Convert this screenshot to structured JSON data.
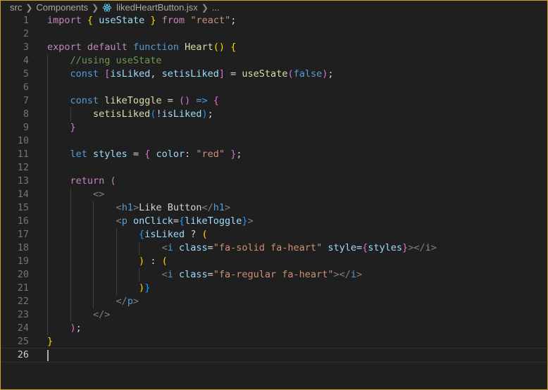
{
  "breadcrumb": {
    "items": [
      "src",
      "Components",
      "likedHeartButton.jsx",
      "..."
    ]
  },
  "editor": {
    "language": "jsx",
    "current_line": 26,
    "lines": [
      {
        "n": "1"
      },
      {
        "n": "2"
      },
      {
        "n": "3"
      },
      {
        "n": "4"
      },
      {
        "n": "5"
      },
      {
        "n": "6"
      },
      {
        "n": "7"
      },
      {
        "n": "8"
      },
      {
        "n": "9"
      },
      {
        "n": "10"
      },
      {
        "n": "11"
      },
      {
        "n": "12"
      },
      {
        "n": "13"
      },
      {
        "n": "14"
      },
      {
        "n": "15"
      },
      {
        "n": "16"
      },
      {
        "n": "17"
      },
      {
        "n": "18"
      },
      {
        "n": "19"
      },
      {
        "n": "20"
      },
      {
        "n": "21"
      },
      {
        "n": "22"
      },
      {
        "n": "23"
      },
      {
        "n": "24"
      },
      {
        "n": "25"
      },
      {
        "n": "26"
      }
    ],
    "tokens": [
      [
        [
          "kw",
          "import"
        ],
        [
          "op",
          " "
        ],
        [
          "b1",
          "{"
        ],
        [
          "op",
          " "
        ],
        [
          "var",
          "useState"
        ],
        [
          "op",
          " "
        ],
        [
          "b1",
          "}"
        ],
        [
          "op",
          " "
        ],
        [
          "kw",
          "from"
        ],
        [
          "op",
          " "
        ],
        [
          "str",
          "\"react\""
        ],
        [
          "op",
          ";"
        ]
      ],
      [],
      [
        [
          "kw",
          "export"
        ],
        [
          "op",
          " "
        ],
        [
          "kw",
          "default"
        ],
        [
          "op",
          " "
        ],
        [
          "kb",
          "function"
        ],
        [
          "op",
          " "
        ],
        [
          "fn",
          "Heart"
        ],
        [
          "b1",
          "()"
        ],
        [
          "op",
          " "
        ],
        [
          "b1",
          "{"
        ]
      ],
      [
        [
          "op",
          "    "
        ],
        [
          "cmt",
          "//using useState"
        ]
      ],
      [
        [
          "op",
          "    "
        ],
        [
          "kb",
          "const"
        ],
        [
          "op",
          " "
        ],
        [
          "b2",
          "["
        ],
        [
          "var",
          "isLiked"
        ],
        [
          "op",
          ", "
        ],
        [
          "var",
          "setisLiked"
        ],
        [
          "b2",
          "]"
        ],
        [
          "op",
          " = "
        ],
        [
          "fn",
          "useState"
        ],
        [
          "b2",
          "("
        ],
        [
          "kb",
          "false"
        ],
        [
          "b2",
          ")"
        ],
        [
          "op",
          ";"
        ]
      ],
      [],
      [
        [
          "op",
          "    "
        ],
        [
          "kb",
          "const"
        ],
        [
          "op",
          " "
        ],
        [
          "fn",
          "likeToggle"
        ],
        [
          "op",
          " = "
        ],
        [
          "b2",
          "()"
        ],
        [
          "op",
          " "
        ],
        [
          "kb",
          "=>"
        ],
        [
          "op",
          " "
        ],
        [
          "b2",
          "{"
        ]
      ],
      [
        [
          "op",
          "        "
        ],
        [
          "fn",
          "setisLiked"
        ],
        [
          "b3",
          "("
        ],
        [
          "op",
          "!"
        ],
        [
          "var",
          "isLiked"
        ],
        [
          "b3",
          ")"
        ],
        [
          "op",
          ";"
        ]
      ],
      [
        [
          "op",
          "    "
        ],
        [
          "b2",
          "}"
        ]
      ],
      [],
      [
        [
          "op",
          "    "
        ],
        [
          "kb",
          "let"
        ],
        [
          "op",
          " "
        ],
        [
          "var",
          "styles"
        ],
        [
          "op",
          " = "
        ],
        [
          "b2",
          "{"
        ],
        [
          "op",
          " "
        ],
        [
          "var",
          "color"
        ],
        [
          "op",
          ": "
        ],
        [
          "str",
          "\"red\""
        ],
        [
          "op",
          " "
        ],
        [
          "b2",
          "}"
        ],
        [
          "op",
          ";"
        ]
      ],
      [],
      [
        [
          "op",
          "    "
        ],
        [
          "kw",
          "return"
        ],
        [
          "op",
          " "
        ],
        [
          "b2",
          "("
        ]
      ],
      [
        [
          "op",
          "        "
        ],
        [
          "tag",
          "<>"
        ]
      ],
      [
        [
          "op",
          "            "
        ],
        [
          "tag",
          "<"
        ],
        [
          "tagn",
          "h1"
        ],
        [
          "tag",
          ">"
        ],
        [
          "op",
          "Like Button"
        ],
        [
          "tag",
          "</"
        ],
        [
          "tagn",
          "h1"
        ],
        [
          "tag",
          ">"
        ]
      ],
      [
        [
          "op",
          "            "
        ],
        [
          "tag",
          "<"
        ],
        [
          "tagn",
          "p"
        ],
        [
          "op",
          " "
        ],
        [
          "attr",
          "onClick"
        ],
        [
          "op",
          "="
        ],
        [
          "b3",
          "{"
        ],
        [
          "var",
          "likeToggle"
        ],
        [
          "b3",
          "}"
        ],
        [
          "tag",
          ">"
        ]
      ],
      [
        [
          "op",
          "                "
        ],
        [
          "b3",
          "{"
        ],
        [
          "var",
          "isLiked"
        ],
        [
          "op",
          " ? "
        ],
        [
          "b1",
          "("
        ]
      ],
      [
        [
          "op",
          "                    "
        ],
        [
          "tag",
          "<"
        ],
        [
          "tagn",
          "i"
        ],
        [
          "op",
          " "
        ],
        [
          "attr",
          "class"
        ],
        [
          "op",
          "="
        ],
        [
          "str",
          "\"fa-solid fa-heart\""
        ],
        [
          "op",
          " "
        ],
        [
          "attr",
          "style"
        ],
        [
          "op",
          "="
        ],
        [
          "b2",
          "{"
        ],
        [
          "var",
          "styles"
        ],
        [
          "b2",
          "}"
        ],
        [
          "tag",
          "></"
        ],
        [
          "tagn",
          "i"
        ],
        [
          "tag",
          ">"
        ]
      ],
      [
        [
          "op",
          "                "
        ],
        [
          "b1",
          ")"
        ],
        [
          "op",
          " : "
        ],
        [
          "b1",
          "("
        ]
      ],
      [
        [
          "op",
          "                    "
        ],
        [
          "tag",
          "<"
        ],
        [
          "tagn",
          "i"
        ],
        [
          "op",
          " "
        ],
        [
          "attr",
          "class"
        ],
        [
          "op",
          "="
        ],
        [
          "str",
          "\"fa-regular fa-heart\""
        ],
        [
          "tag",
          "></"
        ],
        [
          "tagn",
          "i"
        ],
        [
          "tag",
          ">"
        ]
      ],
      [
        [
          "op",
          "                "
        ],
        [
          "b1",
          ")"
        ],
        [
          "b3",
          "}"
        ]
      ],
      [
        [
          "op",
          "            "
        ],
        [
          "tag",
          "</"
        ],
        [
          "tagn",
          "p"
        ],
        [
          "tag",
          ">"
        ]
      ],
      [
        [
          "op",
          "        "
        ],
        [
          "tag",
          "</>"
        ]
      ],
      [
        [
          "op",
          "    "
        ],
        [
          "b2",
          ")"
        ],
        [
          "op",
          ";"
        ]
      ],
      [
        [
          "b1",
          "}"
        ]
      ],
      []
    ]
  }
}
